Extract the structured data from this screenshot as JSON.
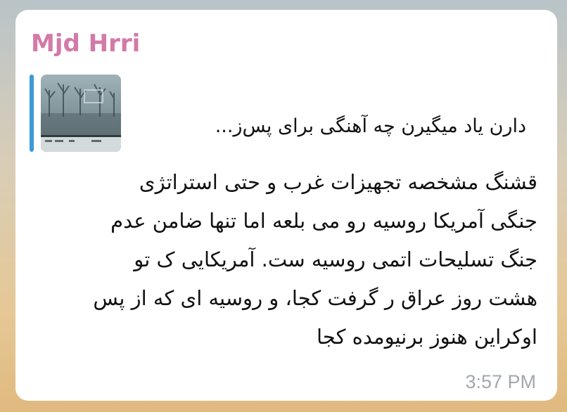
{
  "message": {
    "sender": "Mjd Hrri",
    "reply_text": "دارن یاد میگیرن چه آهنگی برای پس‌ز...",
    "lines": [
      "قشنگ مشخصه تجهیزات غرب و حتی استراتژی",
      "جنگی آمریکا روسیه رو می بلعه اما تنها ضامن عدم",
      "جنگ تسلیحات اتمی روسیه ست. آمریکایی ک تو",
      "هشت روز عراق ر گرفت کجا، و روسیه ای که از پس",
      "اوکراین هنوز برنیومده کجا"
    ],
    "time": "3:57 PM"
  },
  "colors": {
    "sender": "#d27aa8",
    "reply_bar": "#3c9ad6",
    "time": "#a3a8ad",
    "bubble": "#ffffff"
  },
  "icons": {
    "reply_thumbnail": "snowy-forest-photo-thumbnail"
  }
}
